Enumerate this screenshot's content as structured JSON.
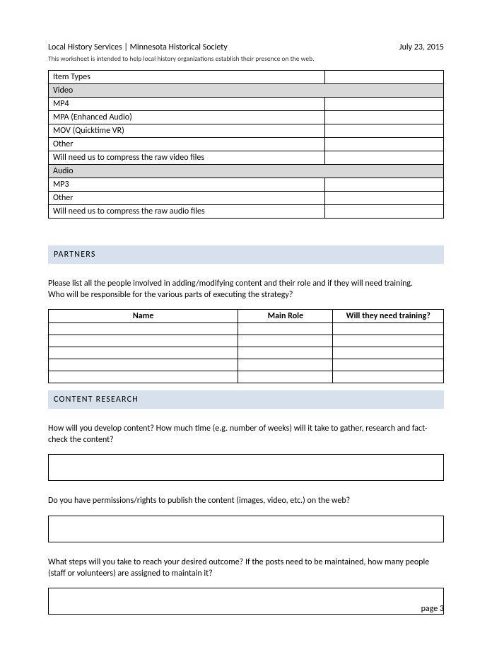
{
  "header": {
    "title": "Local History Services | Minnesota Historical Society",
    "date": "July 23, 2015",
    "subtitle": "This worksheet is intended to help local history organizations establish their presence on the web."
  },
  "item_types": {
    "heading": "Item Types",
    "rows": [
      {
        "label": "Video",
        "shaded": true
      },
      {
        "label": "MP4",
        "shaded": false
      },
      {
        "label": "MPA (Enhanced Audio)",
        "shaded": false
      },
      {
        "label": "MOV (Quicktime VR)",
        "shaded": false
      },
      {
        "label": "Other",
        "shaded": false
      },
      {
        "label": "Will need us to compress the raw video files",
        "shaded": false
      },
      {
        "label": "Audio",
        "shaded": true
      },
      {
        "label": "MP3",
        "shaded": false
      },
      {
        "label": "Other",
        "shaded": false
      },
      {
        "label": "Will need us to compress the raw audio files",
        "shaded": false
      }
    ]
  },
  "partners": {
    "heading": "PARTNERS",
    "intro1": "Please list all the people involved in adding/modifying content and their role and if they will need training.",
    "intro2": "Who will be responsible for the various parts of executing the strategy?",
    "columns": {
      "name": "Name",
      "role": "Main Role",
      "training": "Will they need training?"
    },
    "rows": 5
  },
  "content_research": {
    "heading": "CONTENT RESEARCH",
    "q1": "How will you develop content? How much time (e.g. number of weeks) will it take to gather, research and fact-check the content?",
    "q2": "Do you have permissions/rights to publish the content (images, video, etc.) on the web?",
    "q3": "What steps will you take to reach your desired outcome? If the posts need to be maintained, how many people (staff or volunteers) are assigned to maintain it?"
  },
  "footer": {
    "page": "page 3"
  }
}
